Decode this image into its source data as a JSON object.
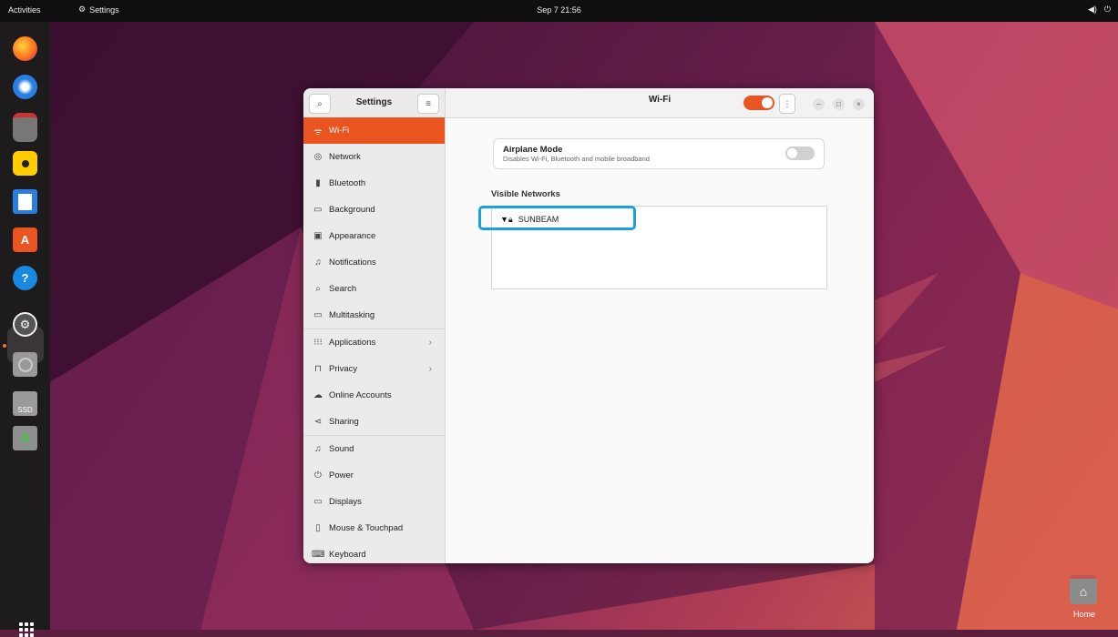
{
  "topbar": {
    "activities": "Activities",
    "app_name": "Settings",
    "clock": "Sep 7  21:56"
  },
  "dock": {
    "items": [
      {
        "name": "firefox-icon"
      },
      {
        "name": "thunderbird-icon"
      },
      {
        "name": "files-icon"
      },
      {
        "name": "rhythmbox-icon"
      },
      {
        "name": "libreoffice-writer-icon"
      },
      {
        "name": "app-center-icon"
      },
      {
        "name": "help-icon"
      },
      {
        "name": "settings-icon"
      },
      {
        "name": "disc-icon"
      },
      {
        "name": "ssd-drive-icon"
      },
      {
        "name": "trash-icon"
      }
    ],
    "ssd_label": "SSD",
    "help_glyph": "?"
  },
  "desktop": {
    "home_label": "Home"
  },
  "settings": {
    "sidebar_title": "Settings",
    "items": [
      {
        "label": "Wi-Fi",
        "icon": "wifi-icon"
      },
      {
        "label": "Network",
        "icon": "network-icon"
      },
      {
        "label": "Bluetooth",
        "icon": "bluetooth-icon"
      },
      {
        "label": "Background",
        "icon": "background-icon"
      },
      {
        "label": "Appearance",
        "icon": "appearance-icon"
      },
      {
        "label": "Notifications",
        "icon": "bell-icon"
      },
      {
        "label": "Search",
        "icon": "search-icon"
      },
      {
        "label": "Multitasking",
        "icon": "multitasking-icon"
      },
      {
        "label": "Applications",
        "icon": "applications-icon"
      },
      {
        "label": "Privacy",
        "icon": "lock-icon"
      },
      {
        "label": "Online Accounts",
        "icon": "cloud-icon"
      },
      {
        "label": "Sharing",
        "icon": "share-icon"
      },
      {
        "label": "Sound",
        "icon": "music-note-icon"
      },
      {
        "label": "Power",
        "icon": "power-icon"
      },
      {
        "label": "Displays",
        "icon": "display-icon"
      },
      {
        "label": "Mouse & Touchpad",
        "icon": "mouse-icon"
      },
      {
        "label": "Keyboard",
        "icon": "keyboard-icon"
      }
    ],
    "main_title": "Wi-Fi",
    "wifi_enabled": true,
    "airplane_title": "Airplane Mode",
    "airplane_subtitle": "Disables Wi-Fi, Bluetooth and mobile broadband",
    "airplane_enabled": false,
    "visible_networks_label": "Visible Networks",
    "networks": [
      {
        "name": "SUNBEAM",
        "secured": true
      }
    ]
  },
  "colors": {
    "accent": "#e95420",
    "highlight": "#1aa0e0"
  }
}
